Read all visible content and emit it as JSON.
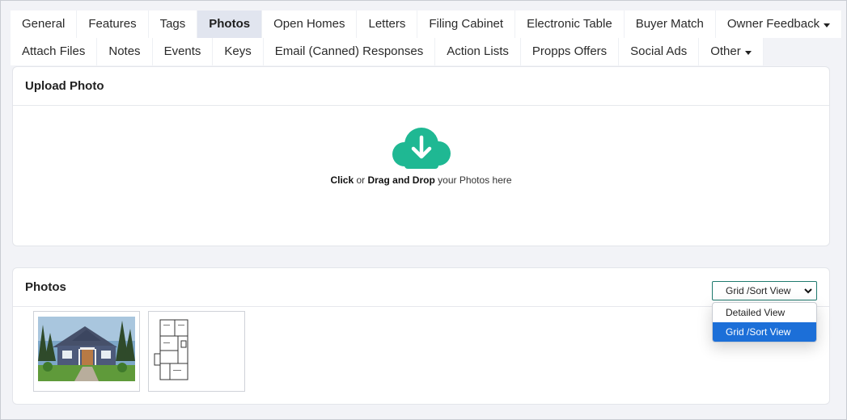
{
  "tabs": {
    "row1": [
      {
        "label": "General"
      },
      {
        "label": "Features"
      },
      {
        "label": "Tags"
      },
      {
        "label": "Photos",
        "active": true
      },
      {
        "label": "Open Homes"
      },
      {
        "label": "Letters"
      },
      {
        "label": "Filing Cabinet"
      },
      {
        "label": "Electronic Table"
      },
      {
        "label": "Buyer Match"
      },
      {
        "label": "Owner Feedback",
        "dropdown": true
      }
    ],
    "row2": [
      {
        "label": "Attach Files"
      },
      {
        "label": "Notes"
      },
      {
        "label": "Events"
      },
      {
        "label": "Keys"
      },
      {
        "label": "Email (Canned) Responses"
      },
      {
        "label": "Action Lists"
      },
      {
        "label": "Propps Offers"
      },
      {
        "label": "Social Ads"
      },
      {
        "label": "Other",
        "dropdown": true
      }
    ]
  },
  "upload": {
    "title": "Upload Photo",
    "click": "Click",
    "or": " or ",
    "drag": "Drag and Drop",
    "suffix": " your Photos here",
    "icon": "cloud-download-icon",
    "icon_color": "#1fb893"
  },
  "photos": {
    "title": "Photos",
    "view_select": {
      "value": "Grid /Sort View",
      "options": [
        "Detailed View",
        "Grid /Sort View"
      ],
      "selected_index": 1
    },
    "thumbnails": [
      {
        "icon": "house-photo"
      },
      {
        "icon": "floor-plan-image"
      }
    ]
  },
  "colors": {
    "accent": "#1fb893",
    "active_tab": "#e1e5ef",
    "dropdown_selected": "#1c6fd8"
  }
}
